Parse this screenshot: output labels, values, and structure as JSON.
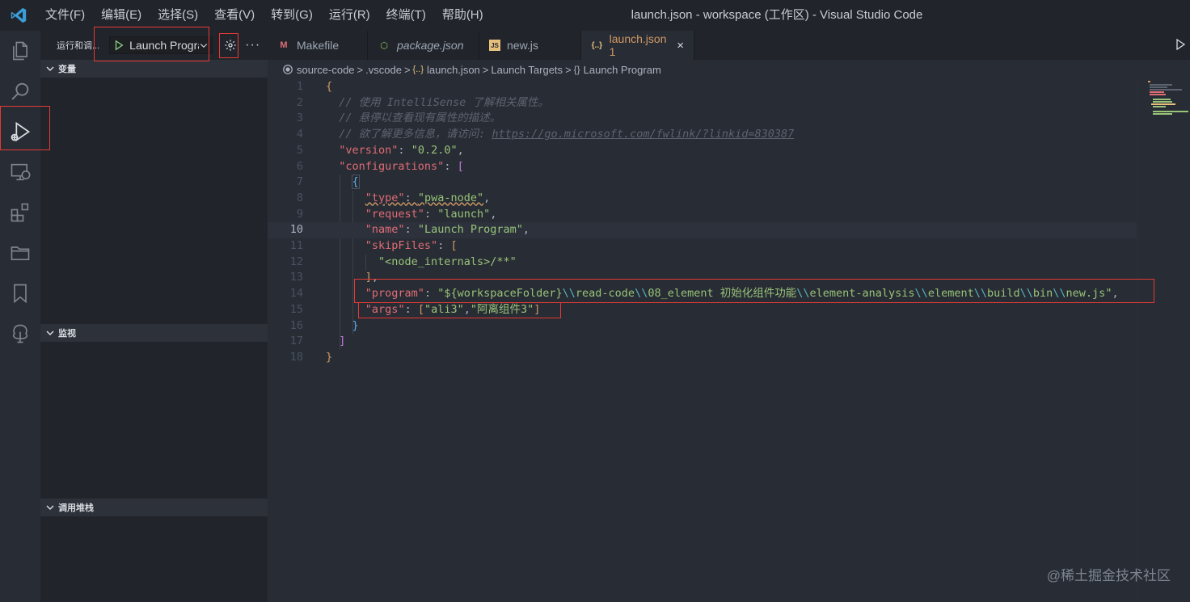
{
  "window": {
    "title": "launch.json - workspace (工作区) - Visual Studio Code",
    "menu": [
      "文件(F)",
      "编辑(E)",
      "选择(S)",
      "查看(V)",
      "转到(G)",
      "运行(R)",
      "终端(T)",
      "帮助(H)"
    ]
  },
  "activity_bar": {
    "items": [
      "explorer-icon",
      "search-icon",
      "run-debug-icon",
      "remote-explorer-icon",
      "extensions-icon",
      "folder-icon",
      "bookmark-icon",
      "tree-icon"
    ]
  },
  "sidebar": {
    "title": "运行和调...",
    "launch_config": "Launch Program",
    "more_label": "···",
    "sections": {
      "variables": "变量",
      "watch": "监视",
      "call_stack": "调用堆栈"
    }
  },
  "tabs": [
    {
      "label": "Makefile",
      "icon": "M"
    },
    {
      "label": "package.json",
      "icon": "⬡"
    },
    {
      "label": "new.js",
      "icon": "JS"
    },
    {
      "label": "launch.json 1",
      "icon": "{..}",
      "active": true
    }
  ],
  "tab_close": "×",
  "breadcrumb": {
    "items": [
      "source-code",
      ".vscode",
      "launch.json",
      "Launch Targets",
      "Launch Program"
    ],
    "sep": ">"
  },
  "editor": {
    "line_numbers": [
      "1",
      "2",
      "3",
      "4",
      "5",
      "6",
      "7",
      "8",
      "9",
      "10",
      "11",
      "12",
      "13",
      "14",
      "15",
      "16",
      "17",
      "18"
    ],
    "current_line": "10",
    "comments": [
      "// 使用 IntelliSense 了解相关属性。",
      "// 悬停以查看现有属性的描述。",
      "// 欲了解更多信息，请访问: "
    ],
    "link": "https://go.microsoft.com/fwlink/?linkid=830387",
    "version_key": "\"version\"",
    "version_val": "\"0.2.0\"",
    "configurations_key": "\"configurations\"",
    "type_key": "\"type\"",
    "type_val": "\"pwa-node\"",
    "request_key": "\"request\"",
    "request_val": "\"launch\"",
    "name_key": "\"name\"",
    "name_val": "\"Launch Program\"",
    "skipfiles_key": "\"skipFiles\"",
    "skipfiles_val": "\"<node_internals>/**\"",
    "program_key": "\"program\"",
    "program_val_1": "\"${workspaceFolder}",
    "program_val_2": "read-code",
    "program_val_3": "08_element 初始化组件功能",
    "program_val_4": "element-analysis",
    "program_val_5": "element",
    "program_val_6": "build",
    "program_val_7": "bin",
    "program_val_8": "new.js\"",
    "escape": "\\\\",
    "args_key": "\"args\"",
    "args_val_1": "\"ali3\"",
    "args_val_2": "\"阿离组件3\""
  },
  "watermark": "@稀土掘金技术社区",
  "colors": {
    "accent_red": "#e53935",
    "comment": "#5c6370",
    "key": "#e06c75",
    "string": "#98c379"
  }
}
